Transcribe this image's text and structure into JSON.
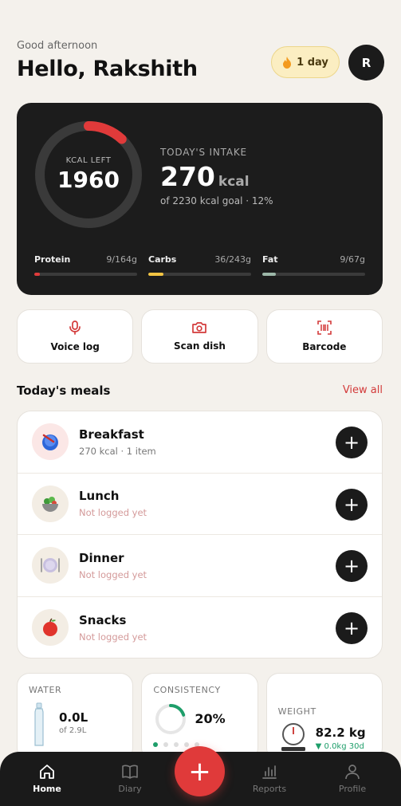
{
  "header": {
    "greeting": "Good afternoon",
    "hello": "Hello, Rakshith",
    "streak_label": "1 day",
    "avatar_initial": "R"
  },
  "summary": {
    "ring_label": "KCAL LEFT",
    "ring_value": "1960",
    "ring_progress": 0.12,
    "intake_label": "TODAY'S INTAKE",
    "intake_value": "270",
    "intake_unit": "kcal",
    "goal_text": "of 2230 kcal goal · 12%",
    "macros": [
      {
        "name": "Protein",
        "value": "9/164g",
        "fraction": 0.055,
        "color": "#e03a3a"
      },
      {
        "name": "Carbs",
        "value": "36/243g",
        "fraction": 0.148,
        "color": "#f2c443"
      },
      {
        "name": "Fat",
        "value": "9/67g",
        "fraction": 0.134,
        "color": "#9cb7a8"
      }
    ]
  },
  "actions": [
    {
      "label": "Voice log",
      "icon": "microphone-icon"
    },
    {
      "label": "Scan dish",
      "icon": "camera-icon"
    },
    {
      "label": "Barcode",
      "icon": "barcode-icon"
    }
  ],
  "meals_section": {
    "title": "Today's meals",
    "view_all": "View all",
    "items": [
      {
        "name": "Breakfast",
        "sub": "270 kcal · 1 item",
        "logged": true,
        "icon": "breakfast-bowl-icon",
        "bg": "#fbe7e6"
      },
      {
        "name": "Lunch",
        "sub": "Not logged yet",
        "logged": false,
        "icon": "salad-bowl-icon",
        "bg": "#f3ede4"
      },
      {
        "name": "Dinner",
        "sub": "Not logged yet",
        "logged": false,
        "icon": "plate-cutlery-icon",
        "bg": "#f3ede4"
      },
      {
        "name": "Snacks",
        "sub": "Not logged yet",
        "logged": false,
        "icon": "apple-icon",
        "bg": "#f3ede4"
      }
    ]
  },
  "stats": {
    "water": {
      "label": "WATER",
      "value": "0.0L",
      "goal": "of 2.9L"
    },
    "consistency": {
      "label": "CONSISTENCY",
      "value": "20%",
      "fraction": 0.2
    },
    "weight": {
      "label": "WEIGHT",
      "value": "82.2 kg",
      "delta": "▼ 0.0kg 30d"
    }
  },
  "nav": {
    "items": [
      {
        "label": "Home",
        "active": true
      },
      {
        "label": "Diary",
        "active": false
      },
      {
        "label": "Reports",
        "active": false
      },
      {
        "label": "Profile",
        "active": false
      }
    ],
    "fab": "+"
  }
}
